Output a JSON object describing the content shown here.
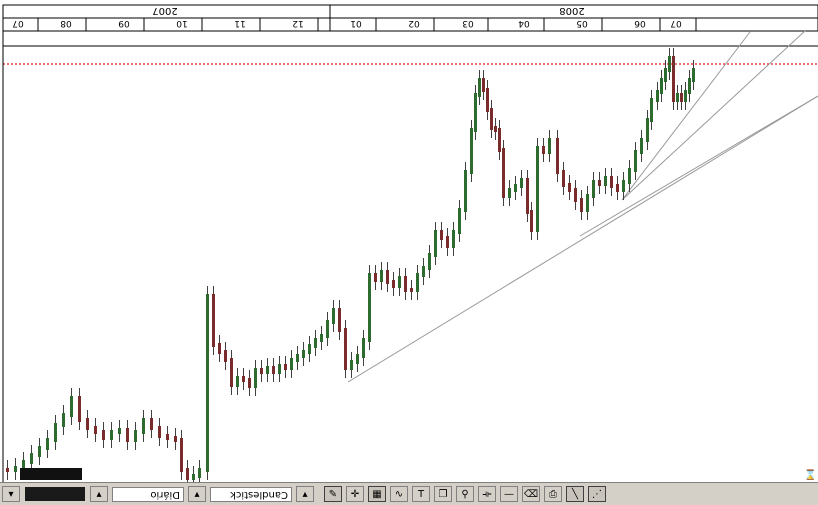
{
  "timeline": {
    "years": [
      "2007",
      "2008"
    ],
    "months": [
      "07",
      "08",
      "09",
      "10",
      "11",
      "12",
      "01",
      "02",
      "03",
      "04",
      "05",
      "06",
      "07"
    ]
  },
  "toolbar": {
    "period": "Diário",
    "chart_style": "Candlestick"
  },
  "chart_data": {
    "type": "candlestick",
    "title": "",
    "note": "Price chart rendered rotated 180 degrees; candles rise from lower-left to upper-right.",
    "resistance_level": "dotted red line",
    "trendlines": 4
  },
  "colors": {
    "up_candle": "#2e6b2e",
    "down_candle": "#7a2b2b",
    "wick": "#404040",
    "resistance": "#e02020",
    "trendline": "#999999"
  }
}
